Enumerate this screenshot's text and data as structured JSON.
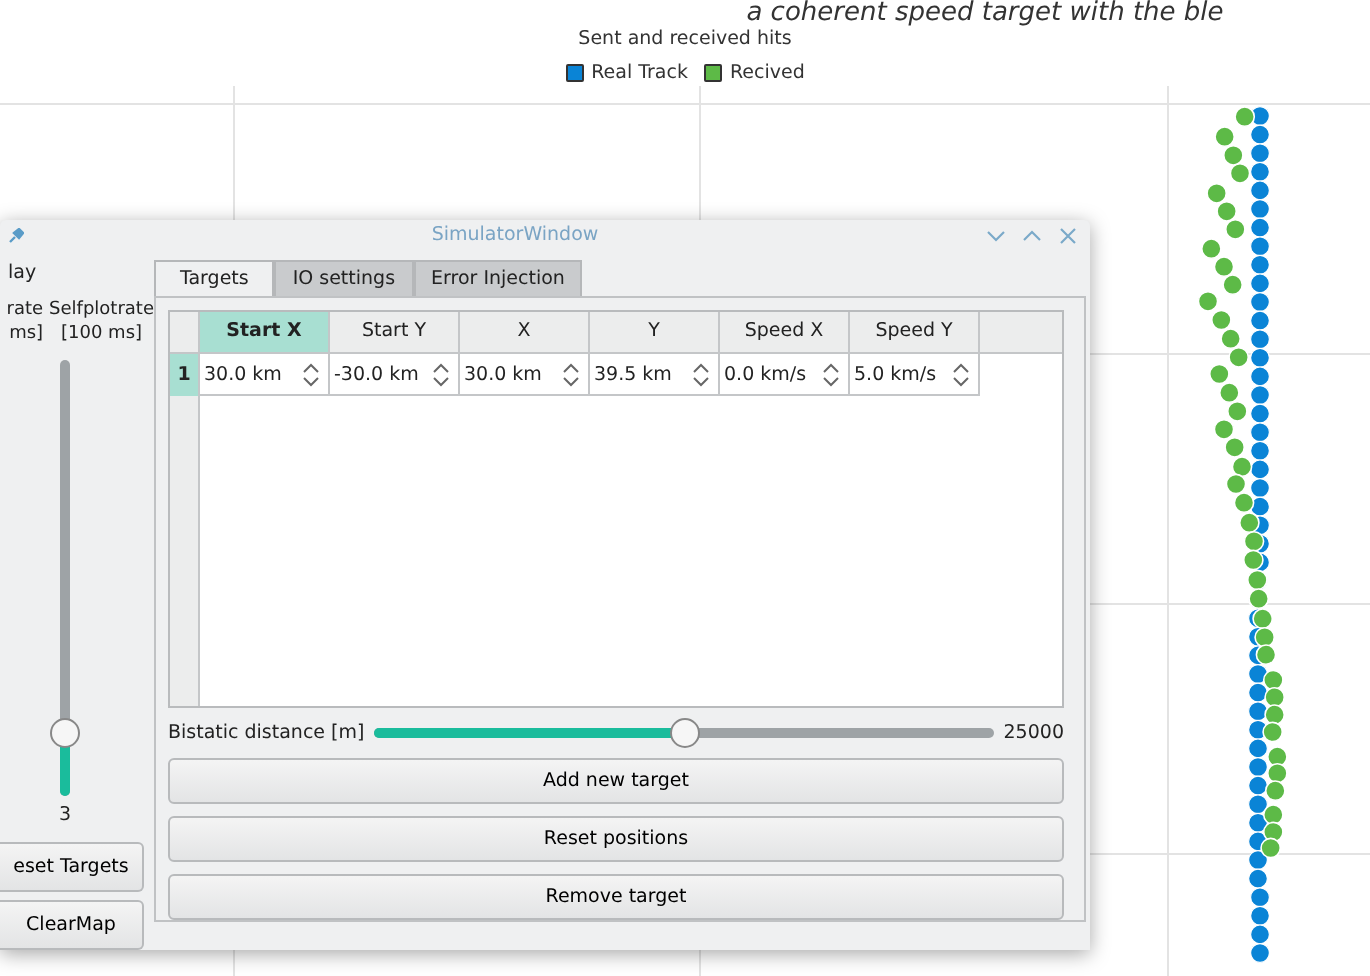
{
  "chart": {
    "title": "a coherent speed target with the ble",
    "subtitle": "Sent and received hits",
    "legend": [
      {
        "label": "Real Track",
        "color": "#0a84d6"
      },
      {
        "label": "Recived",
        "color": "#5dba47"
      }
    ]
  },
  "window": {
    "title": "SimulatorWindow"
  },
  "side_panel": {
    "heading": "lay",
    "rate_label": "rate\nms]",
    "selfplot_label": "Selfplotrate\n[100 ms]",
    "slider": {
      "level": 0.14,
      "value": "3"
    },
    "buttons": [
      "eset Targets",
      "ClearMap"
    ]
  },
  "tabs": [
    {
      "label": "Targets",
      "selected": true
    },
    {
      "label": "IO settings",
      "selected": false
    },
    {
      "label": "Error Injection",
      "selected": false
    }
  ],
  "table": {
    "columns": [
      {
        "label": "Start X",
        "selected": true
      },
      {
        "label": "Start Y",
        "selected": false
      },
      {
        "label": "X",
        "selected": false
      },
      {
        "label": "Y",
        "selected": false
      },
      {
        "label": "Speed X",
        "selected": false
      },
      {
        "label": "Speed Y",
        "selected": false
      }
    ],
    "rows": [
      {
        "header": "1",
        "selected": true,
        "cells": [
          "30.0 km",
          "-30.0 km",
          "30.0 km",
          "39.5 km",
          "0.0 km/s",
          "5.0 km/s"
        ]
      }
    ]
  },
  "distance": {
    "label": "Bistatic distance [m]",
    "level": 0.5,
    "value": "25000"
  },
  "actions": [
    "Add new target",
    "Reset positions",
    "Remove target"
  ]
}
